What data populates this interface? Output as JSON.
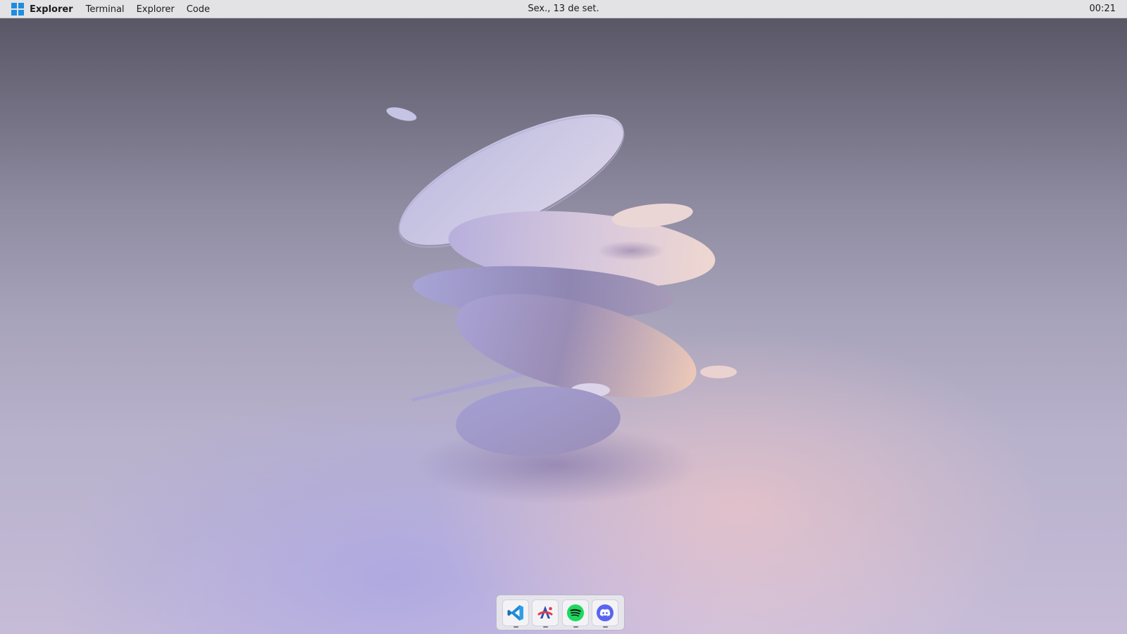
{
  "topbar": {
    "logo_icon": "windows-logo-icon",
    "menu": [
      "Explorer",
      "Terminal",
      "Explorer",
      "Code"
    ],
    "date": "Sex., 13 de set.",
    "time": "00:21"
  },
  "dock": {
    "apps": [
      {
        "name": "Visual Studio Code",
        "icon": "vscode-icon",
        "running": true
      },
      {
        "name": "Design app",
        "icon": "design-app-icon",
        "running": true
      },
      {
        "name": "Spotify",
        "icon": "spotify-icon",
        "running": true
      },
      {
        "name": "Discord",
        "icon": "discord-icon",
        "running": true
      }
    ]
  },
  "colors": {
    "topbar_bg": "#e3e3e6",
    "windows_blue": "#1e8de0",
    "vscode_blue": "#1f8ad2",
    "spotify_green": "#1ed760",
    "discord_blurple": "#5865f2"
  }
}
